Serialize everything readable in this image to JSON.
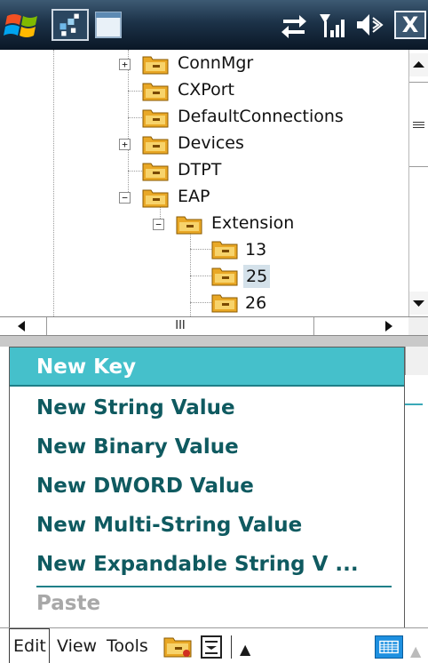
{
  "statusbar": {
    "close_label": "X"
  },
  "tree": {
    "items": [
      {
        "label": "ConnMgr",
        "expander": "+"
      },
      {
        "label": "CXPort",
        "expander": ""
      },
      {
        "label": "DefaultConnections",
        "expander": ""
      },
      {
        "label": "Devices",
        "expander": "+"
      },
      {
        "label": "DTPT",
        "expander": ""
      },
      {
        "label": "EAP",
        "expander": "−"
      },
      {
        "label": "Extension",
        "expander": "−"
      },
      {
        "label": "13",
        "expander": ""
      },
      {
        "label": "25",
        "expander": "",
        "selected": true
      },
      {
        "label": "26",
        "expander": ""
      }
    ]
  },
  "hscroll": {
    "thumb_grip": "III"
  },
  "menu": {
    "items": [
      {
        "label": "New Key",
        "state": "highlighted"
      },
      {
        "label": "New String Value",
        "state": "normal"
      },
      {
        "label": "New Binary Value",
        "state": "normal"
      },
      {
        "label": "New DWORD Value",
        "state": "normal"
      },
      {
        "label": "New Multi-String Value",
        "state": "normal"
      },
      {
        "label": "New Expandable String V ...",
        "state": "normal"
      },
      {
        "label": "Paste",
        "state": "disabled"
      }
    ]
  },
  "menubar": {
    "edit": "Edit",
    "view": "View",
    "tools": "Tools",
    "caret": "▲"
  },
  "colors": {
    "menu_text": "#0f5a60",
    "highlight": "#45c0cb",
    "selection": "#d4e1ea"
  },
  "icons": [
    "windows-start-icon",
    "registry-app-icon",
    "window-app-icon",
    "connectivity-icon",
    "signal-strength-icon",
    "volume-icon",
    "close-icon",
    "folder-icon",
    "properties-icon",
    "keyboard-icon"
  ]
}
